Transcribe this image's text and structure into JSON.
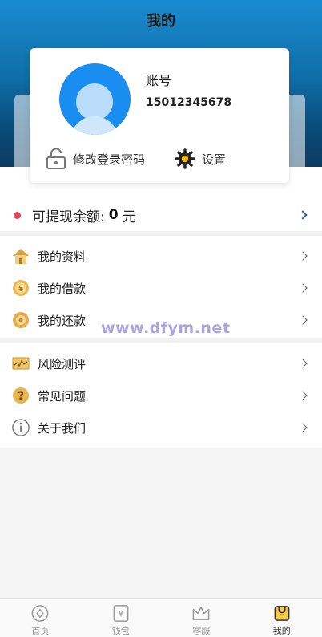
{
  "header": {
    "title": "我的"
  },
  "profile": {
    "account_label": "账号",
    "phone": "15012345678",
    "change_password_label": "修改登录密码",
    "settings_label": "设置"
  },
  "balance": {
    "label": "可提现余额:",
    "amount": "0",
    "unit": "元"
  },
  "menu_group1": [
    {
      "label": "我的资料",
      "icon": "home-icon"
    },
    {
      "label": "我的借款",
      "icon": "yen-coin-icon"
    },
    {
      "label": "我的还款",
      "icon": "coin-icon"
    }
  ],
  "menu_group2": [
    {
      "label": "风险测评",
      "icon": "chart-card-icon"
    },
    {
      "label": "常见问题",
      "icon": "question-icon"
    },
    {
      "label": "关于我们",
      "icon": "info-icon"
    }
  ],
  "watermark": "www.dfym.net",
  "tabs": [
    {
      "label": "首页",
      "icon": "home-compass-icon",
      "active": false
    },
    {
      "label": "钱包",
      "icon": "wallet-yen-icon",
      "active": false
    },
    {
      "label": "客服",
      "icon": "crown-icon",
      "active": false
    },
    {
      "label": "我的",
      "icon": "profile-tab-icon",
      "active": true
    }
  ],
  "colors": {
    "header_top": "#1a8bd0",
    "header_bottom": "#0b3a5e",
    "accent_red": "#e0485a",
    "avatar_blue": "#1a8ef0"
  }
}
